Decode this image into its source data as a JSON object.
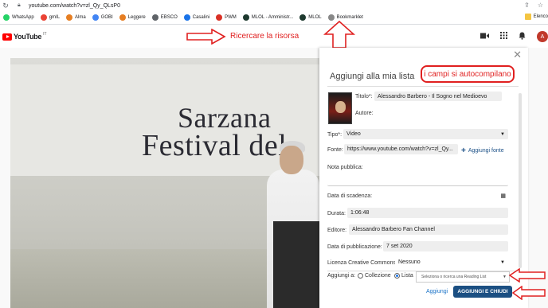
{
  "browser": {
    "url": "youtube.com/watch?v=zl_Qy_QLsP0",
    "bookmarks": [
      {
        "label": "WhatsApp",
        "icon": "whatsapp-icon",
        "color": "#25d366"
      },
      {
        "label": "gmIL",
        "icon": "gmail-icon",
        "color": "#ea4335"
      },
      {
        "label": "Alma",
        "icon": "alma-icon",
        "color": "#e67e22"
      },
      {
        "label": "GOBI",
        "icon": "gobi-icon",
        "color": "#4285f4"
      },
      {
        "label": "Leggere",
        "icon": "leggere-icon",
        "color": "#e67e22"
      },
      {
        "label": "EBSCO",
        "icon": "ebsco-icon",
        "color": "#5f6368"
      },
      {
        "label": "Casalini",
        "icon": "casalini-icon",
        "color": "#1a73e8"
      },
      {
        "label": "PWM",
        "icon": "pwm-icon",
        "color": "#d93025"
      },
      {
        "label": "MLOL - Amministr...",
        "icon": "mlol-icon",
        "color": "#1e3a2f"
      },
      {
        "label": "MLOL",
        "icon": "mlol-icon",
        "color": "#1e3a2f"
      },
      {
        "label": "Bookmarklet",
        "icon": "bookmarklet-icon",
        "color": "#888888"
      }
    ],
    "other_bookmarks": "Elenco"
  },
  "youtube": {
    "logo_text": "YouTube",
    "logo_sup": "IT"
  },
  "annotations": {
    "search_hint": "Ricercare la risorsa",
    "autofill_hint": "i campi si autocompilano"
  },
  "video": {
    "banner_line1": "Sarzana",
    "banner_line2": "Festival del"
  },
  "panel": {
    "title": "Aggiungi alla mia lista",
    "titolo_label": "Titolo*:",
    "titolo_value": "Alessandro Barbero - Il Sogno nel Medioevo",
    "autore_label": "Autore:",
    "tipo_label": "Tipo*:",
    "tipo_value": "Video",
    "fonte_label": "Fonte:",
    "fonte_value": "https://www.youtube.com/watch?v=zl_Qy...",
    "aggiungi_fonte": "Aggiungi fonte",
    "nota_label": "Nota pubblica:",
    "scadenza_label": "Data di scadenza:",
    "durata_label": "Durata:",
    "durata_value": "1:06:48",
    "editore_label": "Editore:",
    "editore_value": "Alessandro Barbero Fan Channel",
    "pubblicazione_label": "Data di pubblicazione:",
    "pubblicazione_value": "7 set 2020",
    "licenza_label": "Licenza Creative Commons:",
    "licenza_value": "Nessuno",
    "aggiungi_a_label": "Aggiungi a:",
    "collezione_label": "Collezione",
    "lista_label": "Lista",
    "reading_list_placeholder": "Seleziona o ricerca una Reading List",
    "aggiungi_button": "Aggiungi",
    "aggiungi_chiudi_button": "AGGIUNGI E CHIUDI"
  },
  "colors": {
    "annotation_red": "#e02020",
    "primary_button": "#1b4f82",
    "youtube_red": "#ff0000"
  }
}
